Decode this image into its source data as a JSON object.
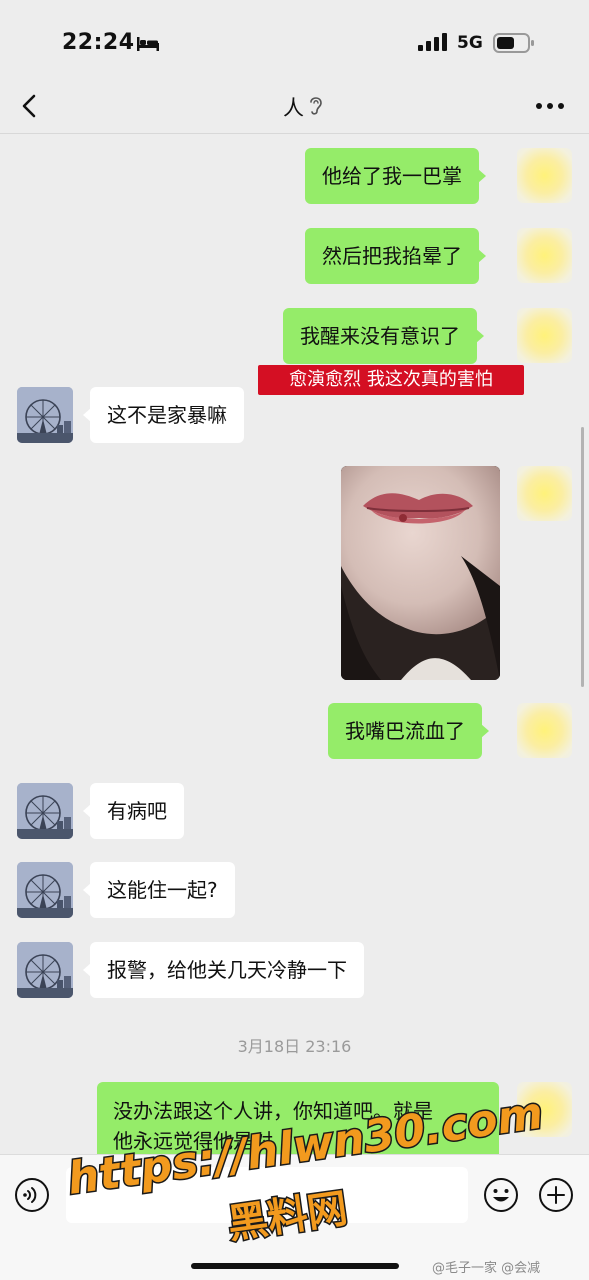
{
  "status_bar": {
    "time": "22:24",
    "network": "5G",
    "icons": [
      "sleep-mode-bed-icon",
      "cellular-signal-icon",
      "battery-icon"
    ]
  },
  "nav": {
    "title": "人",
    "icons": [
      "back-chevron-icon",
      "ear-listening-icon",
      "more-dots-icon"
    ]
  },
  "messages": [
    {
      "side": "right",
      "type": "text",
      "text": "他给了我一巴掌"
    },
    {
      "side": "right",
      "type": "text",
      "text": "然后把我掐晕了"
    },
    {
      "side": "right",
      "type": "text",
      "text": "我醒来没有意识了"
    },
    {
      "side": "left",
      "type": "text",
      "text": "这不是家暴嘛"
    },
    {
      "side": "right",
      "type": "image",
      "description": "photo"
    },
    {
      "side": "right",
      "type": "text",
      "text": "我嘴巴流血了"
    },
    {
      "side": "left",
      "type": "text",
      "text": "有病吧"
    },
    {
      "side": "left",
      "type": "text",
      "text": "这能住一起?"
    },
    {
      "side": "left",
      "type": "text",
      "text": "报警，给他关几天冷静一下"
    }
  ],
  "caption_overlay": "愈演愈烈 我这次真的害怕",
  "timestamp": "3月18日 23:16",
  "last_message": {
    "side": "right",
    "line1": "没办法跟这个人讲，你知道吧。就是",
    "line2": "他永远觉得他是对"
  },
  "input_bar": {
    "placeholder": "",
    "icons": [
      "voice-icon",
      "emoji-icon",
      "plus-icon"
    ]
  },
  "watermark": {
    "url": "https://hlwn30.com",
    "site_name": "黑料网",
    "credit": "@毛子一家 @会减"
  },
  "colors": {
    "background": "#ededed",
    "bubble_green": "#95ec69",
    "bubble_white": "#ffffff",
    "caption_red": "#d40f23",
    "watermark_orange": "#f29a1e"
  }
}
